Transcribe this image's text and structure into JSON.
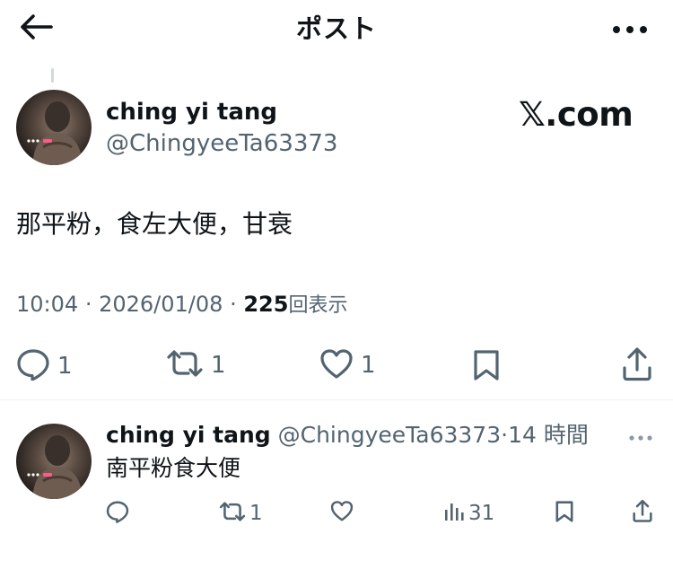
{
  "header": {
    "title": "ポスト",
    "back_icon": "arrow-left-icon",
    "more_icon": "more-horizontal-icon"
  },
  "post": {
    "author_name": "ching yi tang",
    "author_handle": "@ChingyeeTa63373",
    "watermark": "𝕏.com",
    "text": "那平粉，食左大便，甘衰",
    "time": "10:04",
    "separator": "·",
    "date": "2026/01/08",
    "views_count": "225",
    "views_label": "回表示",
    "actions": {
      "reply_count": "1",
      "repost_count": "1",
      "like_count": "1"
    }
  },
  "reply": {
    "author_name": "ching yi tang",
    "author_handle": "@ChingyeeTa63373",
    "separator": "·",
    "time_ago": "14 時間",
    "text": "南平粉食大便",
    "actions": {
      "repost_count": "1",
      "views_count": "31"
    }
  },
  "colors": {
    "text_primary": "#0f1419",
    "text_secondary": "#536471",
    "divider": "#eff3f4",
    "background": "#ffffff"
  }
}
